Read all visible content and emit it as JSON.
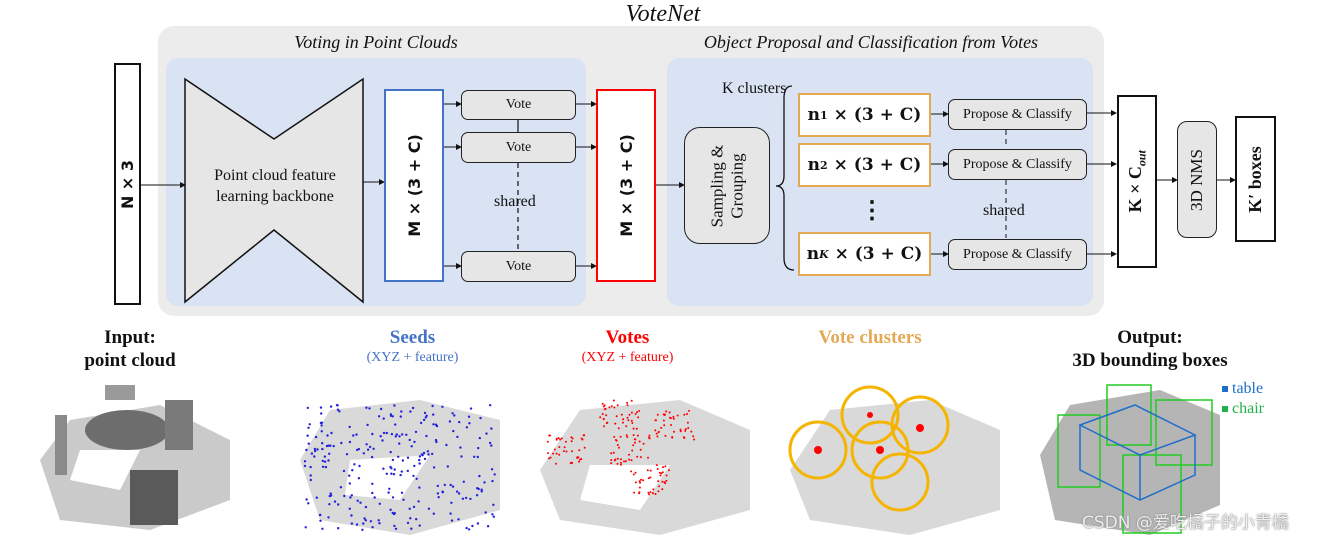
{
  "title": "VoteNet",
  "sections": {
    "voting": {
      "title": "Voting in Point Clouds"
    },
    "proposal": {
      "title": "Object Proposal and Classification from Votes"
    }
  },
  "blocks": {
    "input": "N × 3",
    "backbone": [
      "Point cloud feature",
      "learning backbone"
    ],
    "seeds_tensor": "M × (3 + C)",
    "vote_modules": [
      "Vote",
      "Vote",
      "Vote"
    ],
    "voting_shared": "shared",
    "votes_tensor": "M × (3 + C)",
    "sampling": [
      "Sampling &",
      "Grouping"
    ],
    "k_clusters": "K clusters",
    "clusters": [
      {
        "n": "n",
        "sub": "1",
        "rest": " × (3 + C)"
      },
      {
        "n": "n",
        "sub": "2",
        "rest": " × (3 + C)"
      },
      {
        "n": "n",
        "sub": "K",
        "rest": " × (3 + C)"
      }
    ],
    "cluster_ellipsis": "⋮",
    "propose": [
      "Propose & Classify",
      "Propose & Classify",
      "Propose & Classify"
    ],
    "proposal_shared": "shared",
    "output_tensor": {
      "main": "K × C",
      "sub": "out"
    },
    "nms": "3D NMS",
    "final": "K′ boxes"
  },
  "captions": {
    "input": [
      "Input:",
      "point cloud"
    ],
    "seeds": {
      "title": "Seeds",
      "sub": "(XYZ + feature)"
    },
    "votes": {
      "title": "Votes",
      "sub": "(XYZ + feature)"
    },
    "clusters": {
      "title": "Vote clusters"
    },
    "output": [
      "Output:",
      "3D bounding boxes"
    ]
  },
  "legend": [
    {
      "label": "table",
      "color": "#1f6fc8"
    },
    {
      "label": "chair",
      "color": "#22b04a"
    }
  ],
  "colors": {
    "seeds": "#4472c4",
    "votes": "#ff0000",
    "clusters": "#e4a955",
    "panel_outer": "#ececec",
    "panel_inner": "#dae3f3",
    "cluster_ring": "#f5b400"
  },
  "watermark": "CSDN @爱吃橘子的小青橘"
}
